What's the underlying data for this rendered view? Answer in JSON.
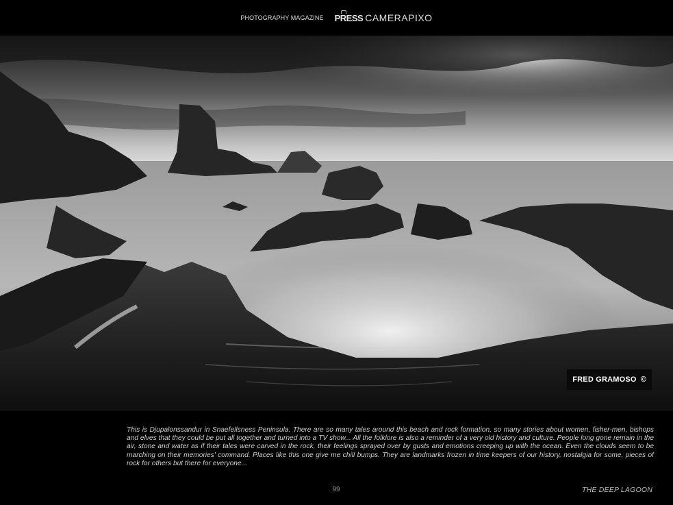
{
  "header": {
    "magazine_label": "PHOTOGRAPHY MAGAZINE",
    "brand_press": "PRESS",
    "brand_name": "CAMERAPIXO"
  },
  "photo": {
    "credit_name": "FRED GRAMOSO",
    "credit_symbol": "©"
  },
  "caption": "This is Djupalonssandur in Snaefellsness Peninsula. There are so many tales around this beach and rock formation, so many stories about women, fisher-men, bishops and elves that they could be put all together and turned into a TV show... All the folklore is also a reminder of a very old history and culture. People long gone remain in the air, stone and water as if their tales were carved in the rock, their feelings sprayed over by gusts and emotions creeping up with the ocean. Even the clouds seem to be marching on their memories' command. Places like this one give me chill bumps. They are landmarks frozen in time keepers of our history, nostalgia for some, pieces of rock for others but there for everyone...",
  "footer": {
    "page_number": "99",
    "title": "THE DEEP LAGOON"
  }
}
